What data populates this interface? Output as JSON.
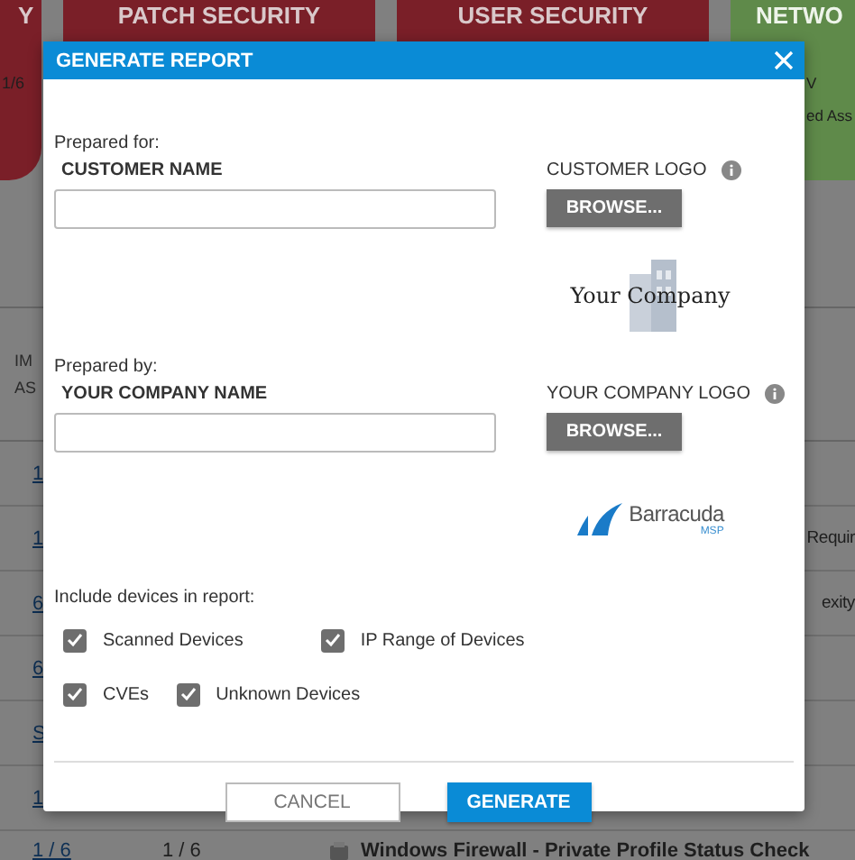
{
  "background": {
    "tiles": [
      {
        "title": "Y",
        "color": "#7a1f28",
        "lines": [
          "1/6"
        ]
      },
      {
        "title": "PATCH SECURITY",
        "color": "#7a1f28"
      },
      {
        "title": "USER SECURITY",
        "color": "#7a1f28"
      },
      {
        "title": "NETWO",
        "color": "#5f8a4a",
        "lines": [
          "V",
          "ed Ass"
        ]
      }
    ],
    "table": {
      "header": [
        "IM",
        "AS"
      ],
      "rows": [
        {
          "column_1": "1"
        },
        {
          "column_1": "1",
          "column_tail": "Requir"
        },
        {
          "column_1": "6",
          "column_tail": "exity"
        },
        {
          "column_1": "6"
        },
        {
          "column_1": "S"
        },
        {
          "column_1": "1"
        },
        {
          "column_1": "1 / 6",
          "column_2": "1 / 6",
          "column_3": "Windows Firewall - Private Profile Status Check"
        }
      ]
    }
  },
  "dialog": {
    "title": "GENERATE REPORT",
    "sections": [
      {
        "caption": "Prepared for:",
        "name_label": "CUSTOMER NAME",
        "logo_label": "CUSTOMER LOGO",
        "browse": "BROWSE...",
        "logo": {
          "kind": "company",
          "text": "Your Company"
        }
      },
      {
        "caption": "Prepared by:",
        "name_label": "YOUR COMPANY NAME",
        "logo_label": "YOUR COMPANY LOGO",
        "browse": "BROWSE...",
        "logo": {
          "kind": "brand",
          "text": "Barracuda",
          "subtext": "MSP"
        }
      }
    ],
    "devices": {
      "caption": "Include devices in report:",
      "rows": [
        [
          {
            "label": "Scanned Devices",
            "checked": true
          },
          {
            "label": "IP Range of Devices",
            "checked": true
          }
        ],
        [
          {
            "label": "CVEs",
            "checked": true
          },
          {
            "label": "Unknown Devices",
            "checked": true
          }
        ]
      ]
    },
    "buttons": [
      {
        "label": "CANCEL",
        "kind": "secondary"
      },
      {
        "label": "GENERATE",
        "kind": "primary"
      }
    ]
  }
}
